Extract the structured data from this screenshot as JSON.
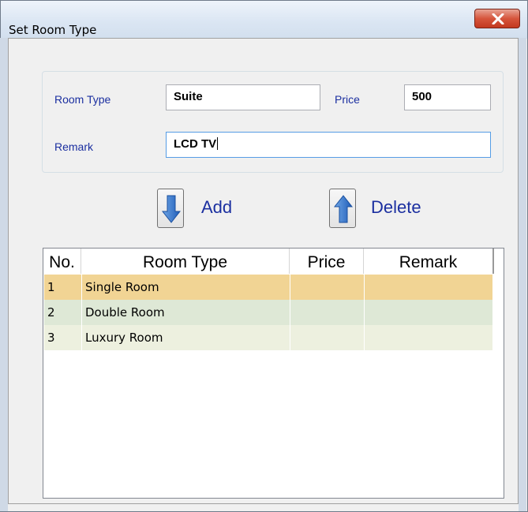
{
  "window": {
    "title": "Set Room Type",
    "close_glyph": "x"
  },
  "form": {
    "room_type_label": "Room Type",
    "room_type_value": "Suite",
    "price_label": "Price",
    "price_value": "500",
    "remark_label": "Remark",
    "remark_value": "LCD TV"
  },
  "actions": {
    "add_label": "Add",
    "delete_label": "Delete"
  },
  "table": {
    "columns": [
      "No.",
      "Room Type",
      "Price",
      "Remark"
    ],
    "rows": [
      {
        "no": "1",
        "room_type": "Single Room",
        "price": "",
        "remark": ""
      },
      {
        "no": "2",
        "room_type": "Double Room",
        "price": "",
        "remark": ""
      },
      {
        "no": "3",
        "room_type": "Luxury Room",
        "price": "",
        "remark": ""
      }
    ],
    "row_colors": [
      "#f1d494",
      "#dee8d6",
      "#edf0df"
    ]
  }
}
